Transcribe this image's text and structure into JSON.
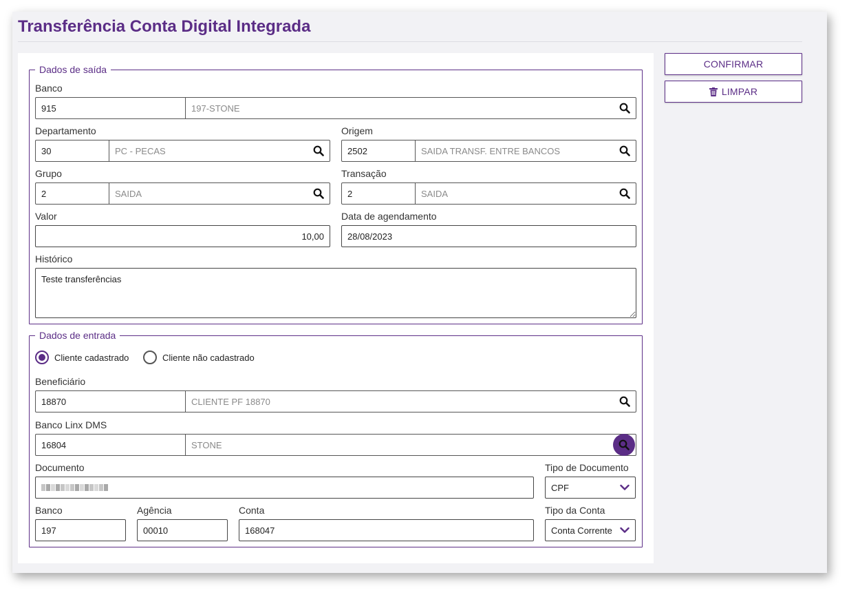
{
  "page": {
    "title": "Transferência Conta Digital Integrada"
  },
  "actions": {
    "confirm_label": "CONFIRMAR",
    "clear_label": "LIMPAR"
  },
  "saida": {
    "legend": "Dados de saída",
    "banco": {
      "label": "Banco",
      "code": "915",
      "desc": "197-STONE"
    },
    "departamento": {
      "label": "Departamento",
      "code": "30",
      "desc": "PC - PECAS"
    },
    "origem": {
      "label": "Origem",
      "code": "2502",
      "desc": "SAIDA TRANSF. ENTRE BANCOS"
    },
    "grupo": {
      "label": "Grupo",
      "code": "2",
      "desc": "SAIDA"
    },
    "transacao": {
      "label": "Transação",
      "code": "2",
      "desc": "SAIDA"
    },
    "valor": {
      "label": "Valor",
      "value": "10,00"
    },
    "data_agendamento": {
      "label": "Data de agendamento",
      "value": "28/08/2023"
    },
    "historico": {
      "label": "Histórico",
      "value": "Teste transferências"
    }
  },
  "entrada": {
    "legend": "Dados de entrada",
    "radio_cadastrado": "Cliente cadastrado",
    "radio_nao_cadastrado": "Cliente não cadastrado",
    "selected": "cadastrado",
    "beneficiario": {
      "label": "Beneficiário",
      "code": "18870",
      "desc": "CLIENTE PF 18870"
    },
    "banco_linx": {
      "label": "Banco Linx DMS",
      "code": "16804",
      "desc": "STONE"
    },
    "documento": {
      "label": "Documento"
    },
    "tipo_documento": {
      "label": "Tipo de Documento",
      "value": "CPF"
    },
    "banco": {
      "label": "Banco",
      "value": "197"
    },
    "agencia": {
      "label": "Agência",
      "value": "00010"
    },
    "conta": {
      "label": "Conta",
      "value": "168047"
    },
    "tipo_conta": {
      "label": "Tipo da Conta",
      "value": "Conta Corrente"
    }
  },
  "colors": {
    "accent": "#5b2d86",
    "background": "#f2f2f5"
  },
  "icons": {
    "lookup": "search-icon",
    "clear": "trash-icon",
    "dropdown": "chevron-down-icon"
  }
}
